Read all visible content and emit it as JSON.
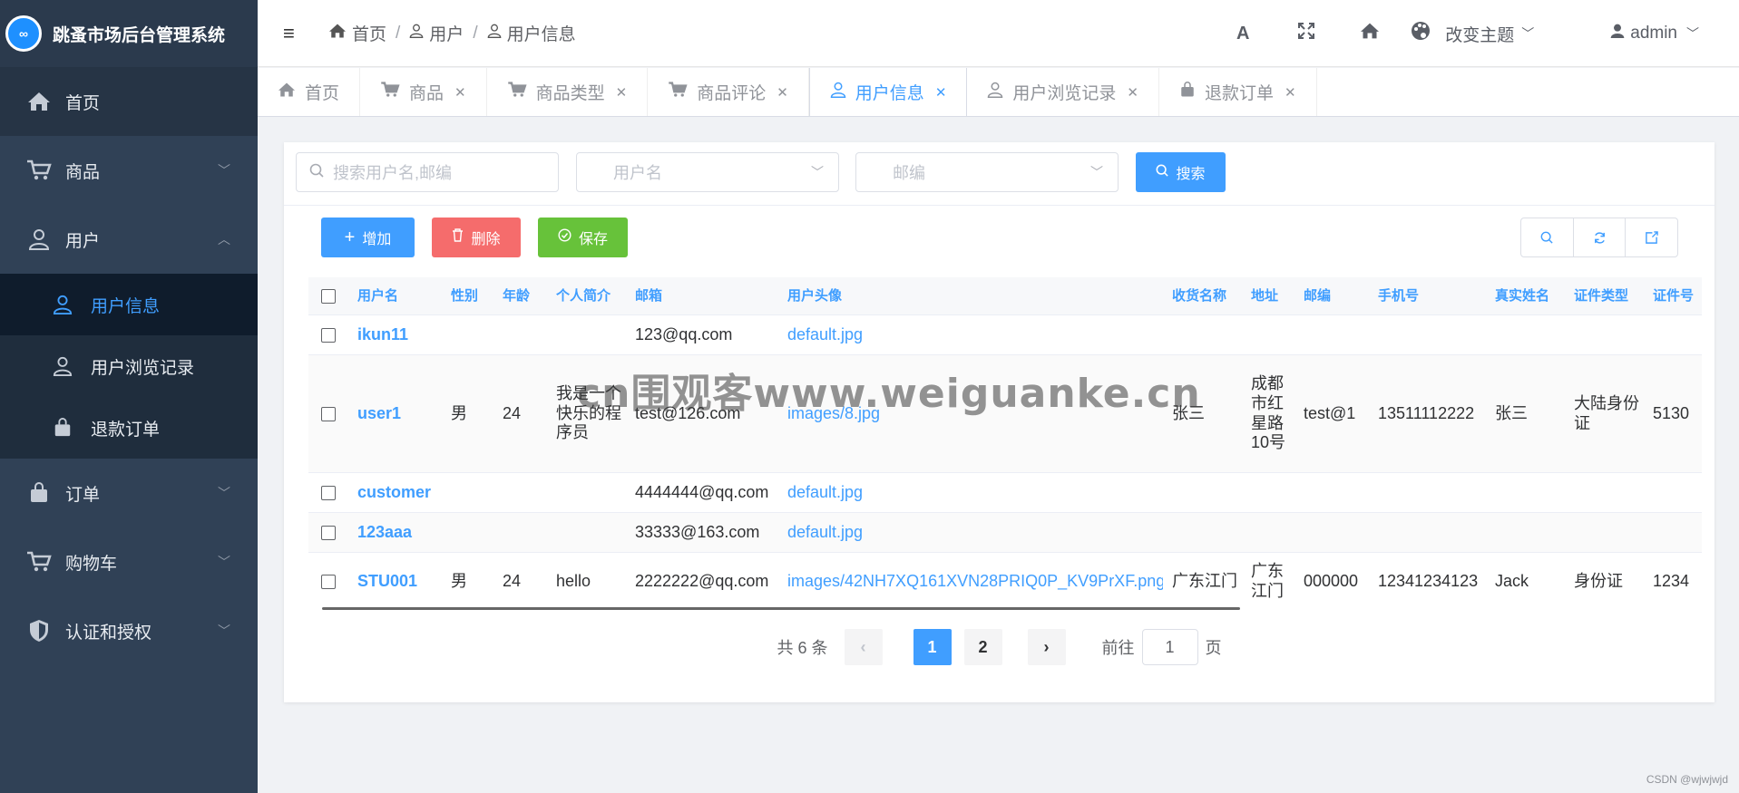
{
  "app": {
    "logo_text": "∞",
    "title": "跳蚤市场后台管理系统"
  },
  "sidebar": {
    "items": [
      {
        "label": "首页",
        "icon": "home-icon"
      },
      {
        "label": "商品",
        "icon": "cart-icon"
      },
      {
        "label": "用户",
        "icon": "user-icon"
      },
      {
        "label": "订单",
        "icon": "bag-icon"
      },
      {
        "label": "购物车",
        "icon": "cart-icon"
      },
      {
        "label": "认证和授权",
        "icon": "shield-icon"
      }
    ],
    "user_sub": [
      {
        "label": "用户信息",
        "active": true
      },
      {
        "label": "用户浏览记录"
      },
      {
        "label": "退款订单"
      }
    ]
  },
  "header": {
    "breadcrumb": [
      "首页",
      "用户",
      "用户信息"
    ],
    "font_icon": "A",
    "theme_label": "改变主题",
    "user_label": "admin"
  },
  "tags": [
    "首页",
    "商品",
    "商品类型",
    "商品评论",
    "用户信息",
    "用户浏览记录",
    "退款订单"
  ],
  "search": {
    "keyword_placeholder": "搜索用户名,邮编",
    "username_placeholder": "用户名",
    "zipcode_placeholder": "邮编",
    "search_button": "搜索"
  },
  "actions": {
    "add": "增加",
    "delete": "删除",
    "save": "保存"
  },
  "table": {
    "columns": [
      "用户名",
      "性别",
      "年龄",
      "个人简介",
      "邮箱",
      "用户头像",
      "收货名称",
      "地址",
      "邮编",
      "手机号",
      "真实姓名",
      "证件类型",
      "证件号"
    ],
    "rows": [
      [
        "ikun11",
        "",
        "",
        "",
        "123@qq.com",
        "default.jpg",
        "",
        "",
        "",
        "",
        "",
        "",
        ""
      ],
      [
        "user1",
        "男",
        "24",
        "我是一个快乐的程序员",
        "test@126.com",
        "images/8.jpg",
        "张三",
        "成都市红星路10号",
        "test@1",
        "13511112222",
        "张三",
        "大陆身份证",
        "5130"
      ],
      [
        "customer",
        "",
        "",
        "",
        "4444444@qq.com",
        "default.jpg",
        "",
        "",
        "",
        "",
        "",
        "",
        ""
      ],
      [
        "123aaa",
        "",
        "",
        "",
        "33333@163.com",
        "default.jpg",
        "",
        "",
        "",
        "",
        "",
        "",
        ""
      ],
      [
        "STU001",
        "男",
        "24",
        "hello",
        "2222222@qq.com",
        "images/42NH7XQ161XVN28PRIQ0P_KV9PrXF.png",
        "广东江门",
        "广东江门",
        "000000",
        "12341234123",
        "Jack",
        "身份证",
        "1234"
      ]
    ]
  },
  "pagination": {
    "total": "共 6 条",
    "pages": [
      "1",
      "2"
    ],
    "current": "1",
    "goto_prefix": "前往",
    "goto_value": "1",
    "goto_suffix": "页"
  },
  "watermark": "cn围观客www.weiguanke.cn",
  "credit": "CSDN @wjwjwjd",
  "colors": {
    "sidebar": "#304156",
    "primary": "#409eff",
    "danger": "#f56c6c",
    "success": "#67c23a"
  }
}
